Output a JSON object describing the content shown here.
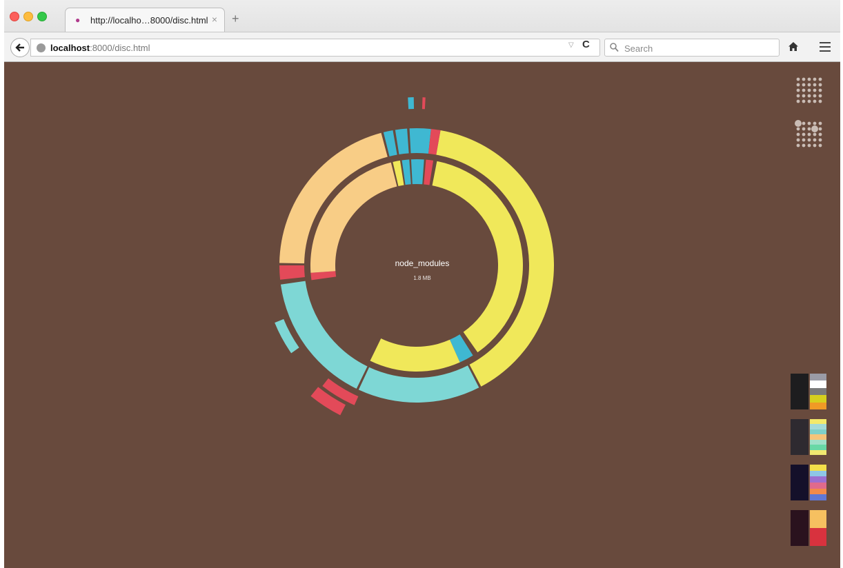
{
  "browser": {
    "tab_title": "http://localho…8000/disc.html",
    "tab_close": "×",
    "new_tab": "+",
    "url_host": "localhost",
    "url_rest": ":8000/disc.html",
    "search_placeholder": "Search"
  },
  "center": {
    "name": "node_modules",
    "size": "1.8 MB"
  },
  "colors": {
    "background": "#684a3d",
    "yellow": "#f0e85a",
    "orange": "#f8cd86",
    "cyan": "#7ed7d5",
    "blue": "#3fb8d2",
    "red": "#e34a59"
  },
  "icons": {
    "back": "back-arrow-icon",
    "globe": "globe-icon",
    "dropdown": "dropdown-icon",
    "reload": "reload-icon",
    "search": "search-icon",
    "home": "home-icon",
    "menu": "hamburger-menu-icon",
    "layout_grid": "dot-grid-icon",
    "layout_sized": "sized-dot-grid-icon"
  },
  "palettes": [
    {
      "name": "dark-gray",
      "base": "#1d1d1f",
      "stripes": [
        "#9a9ba6",
        "#ffffff",
        "#7a7a7a",
        "#d6cf1e",
        "#f09a26"
      ]
    },
    {
      "name": "pastel",
      "base": "#2e2a30",
      "stripes": [
        "#f3e96a",
        "#a3dad8",
        "#7fd0c8",
        "#f5c47a",
        "#9fe0c8",
        "#68d8a6",
        "#f0e870"
      ]
    },
    {
      "name": "neon",
      "base": "#14102a",
      "stripes": [
        "#f4e04a",
        "#8ec6e6",
        "#9c6fd0",
        "#e06a8c",
        "#f28a4a",
        "#5f78d6"
      ]
    },
    {
      "name": "warm",
      "base": "#2a121e",
      "stripes": [
        "#f6c060",
        "#d8323e"
      ]
    }
  ]
}
